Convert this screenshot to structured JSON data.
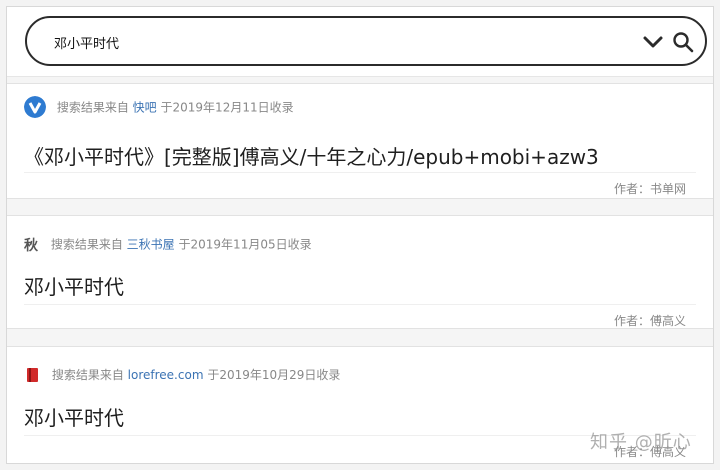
{
  "search": {
    "query": "邓小平时代"
  },
  "results": [
    {
      "source_prefix": "搜索结果来自",
      "source_site": "快吧",
      "source_date": "于2019年12月11日收录",
      "icon": "kuaiba-logo-icon",
      "title": "《邓小平时代》[完整版]傅高义/十年之心力/epub+mobi+azw3",
      "author": "作者：书单网"
    },
    {
      "source_prefix": "搜索结果来自",
      "source_site": "三秋书屋",
      "source_date": "于2019年11月05日收录",
      "icon": "sanqiu-logo-icon",
      "icon_text": "秋",
      "title": "邓小平时代",
      "author": "作者：傅高义"
    },
    {
      "source_prefix": "搜索结果来自",
      "source_site": "lorefree.com",
      "source_date": "于2019年10月29日收录",
      "icon": "red-book-icon",
      "title": "邓小平时代",
      "author": "作者：傅高义"
    }
  ],
  "watermark": "知乎 @昕心",
  "colors": {
    "link": "#3b73b3",
    "meta": "#888888",
    "kuaiba_logo": "#2e7bd1",
    "book_icon": "#d12a2a"
  }
}
